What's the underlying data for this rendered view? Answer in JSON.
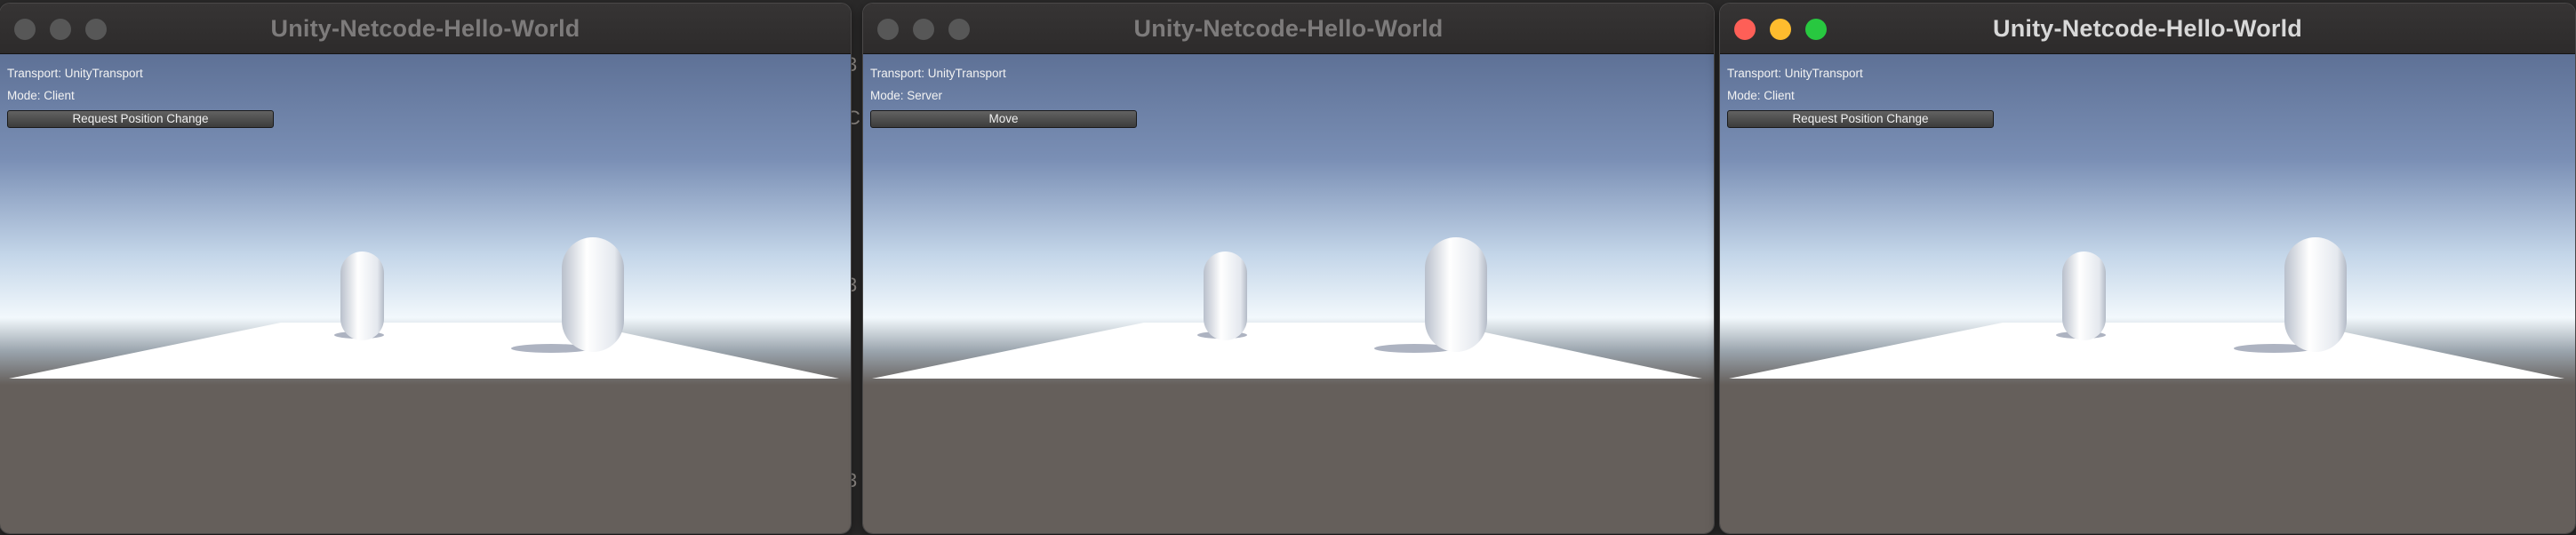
{
  "windows": [
    {
      "title": "Unity-Netcode-Hello-World",
      "focused": false,
      "traffic_lights": {
        "close": "#575757",
        "minimize": "#575757",
        "zoom": "#575757"
      },
      "transport_text": "Transport: UnityTransport",
      "mode_text": "Mode: Client",
      "button_label": "Request Position Change"
    },
    {
      "title": "Unity-Netcode-Hello-World",
      "focused": false,
      "traffic_lights": {
        "close": "#575757",
        "minimize": "#575757",
        "zoom": "#575757"
      },
      "transport_text": "Transport: UnityTransport",
      "mode_text": "Mode: Server",
      "button_label": "Move"
    },
    {
      "title": "Unity-Netcode-Hello-World",
      "focused": true,
      "traffic_lights": {
        "close": "#fe5f57",
        "minimize": "#febc2e",
        "zoom": "#28c840"
      },
      "transport_text": "Transport: UnityTransport",
      "mode_text": "Mode: Client",
      "button_label": "Request Position Change"
    }
  ],
  "colors": {
    "title_inactive": "#7d7b7b",
    "title_active": "#d8d8d8",
    "sky_top": "#5e7196",
    "horizon": "#f2f8fc",
    "ground": "#655f5b",
    "plane": "#ffffff",
    "capsule": "#e9edf3"
  }
}
